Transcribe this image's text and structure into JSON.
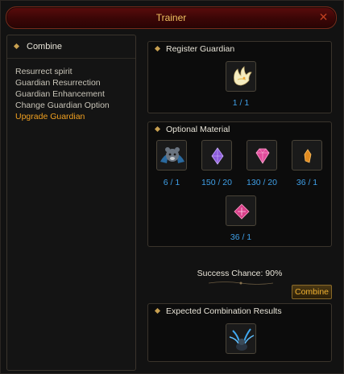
{
  "window": {
    "title": "Trainer"
  },
  "left_panel": {
    "header": "Combine",
    "menu": [
      {
        "label": "Resurrect spirit",
        "active": false
      },
      {
        "label": "Guardian Resurrection",
        "active": false
      },
      {
        "label": "Guardian Enhancement",
        "active": false
      },
      {
        "label": "Change Guardian Option",
        "active": false
      },
      {
        "label": "Upgrade Guardian",
        "active": true
      }
    ]
  },
  "register": {
    "title": "Register Guardian",
    "slot": {
      "icon": "guardian-wing-icon",
      "count": "1 / 1"
    }
  },
  "optional": {
    "title": "Optional Material",
    "slots": [
      {
        "icon": "bear-guardian-icon",
        "count": "6 / 1"
      },
      {
        "icon": "purple-crystal-icon",
        "count": "150 / 20"
      },
      {
        "icon": "pink-gem-icon",
        "count": "130 / 20"
      },
      {
        "icon": "orange-shard-icon",
        "count": "36 / 1"
      },
      {
        "icon": "pink-cube-icon",
        "count": "36 / 1"
      }
    ]
  },
  "success": {
    "text": "Success Chance: 90%"
  },
  "combine_button": {
    "label": "Combine"
  },
  "results": {
    "title": "Expected Combination Results",
    "slot": {
      "icon": "blue-dragon-guardian-icon"
    }
  },
  "colors": {
    "count": "#3fa0e8",
    "active_menu": "#f0a020",
    "title": "#f0c060"
  }
}
